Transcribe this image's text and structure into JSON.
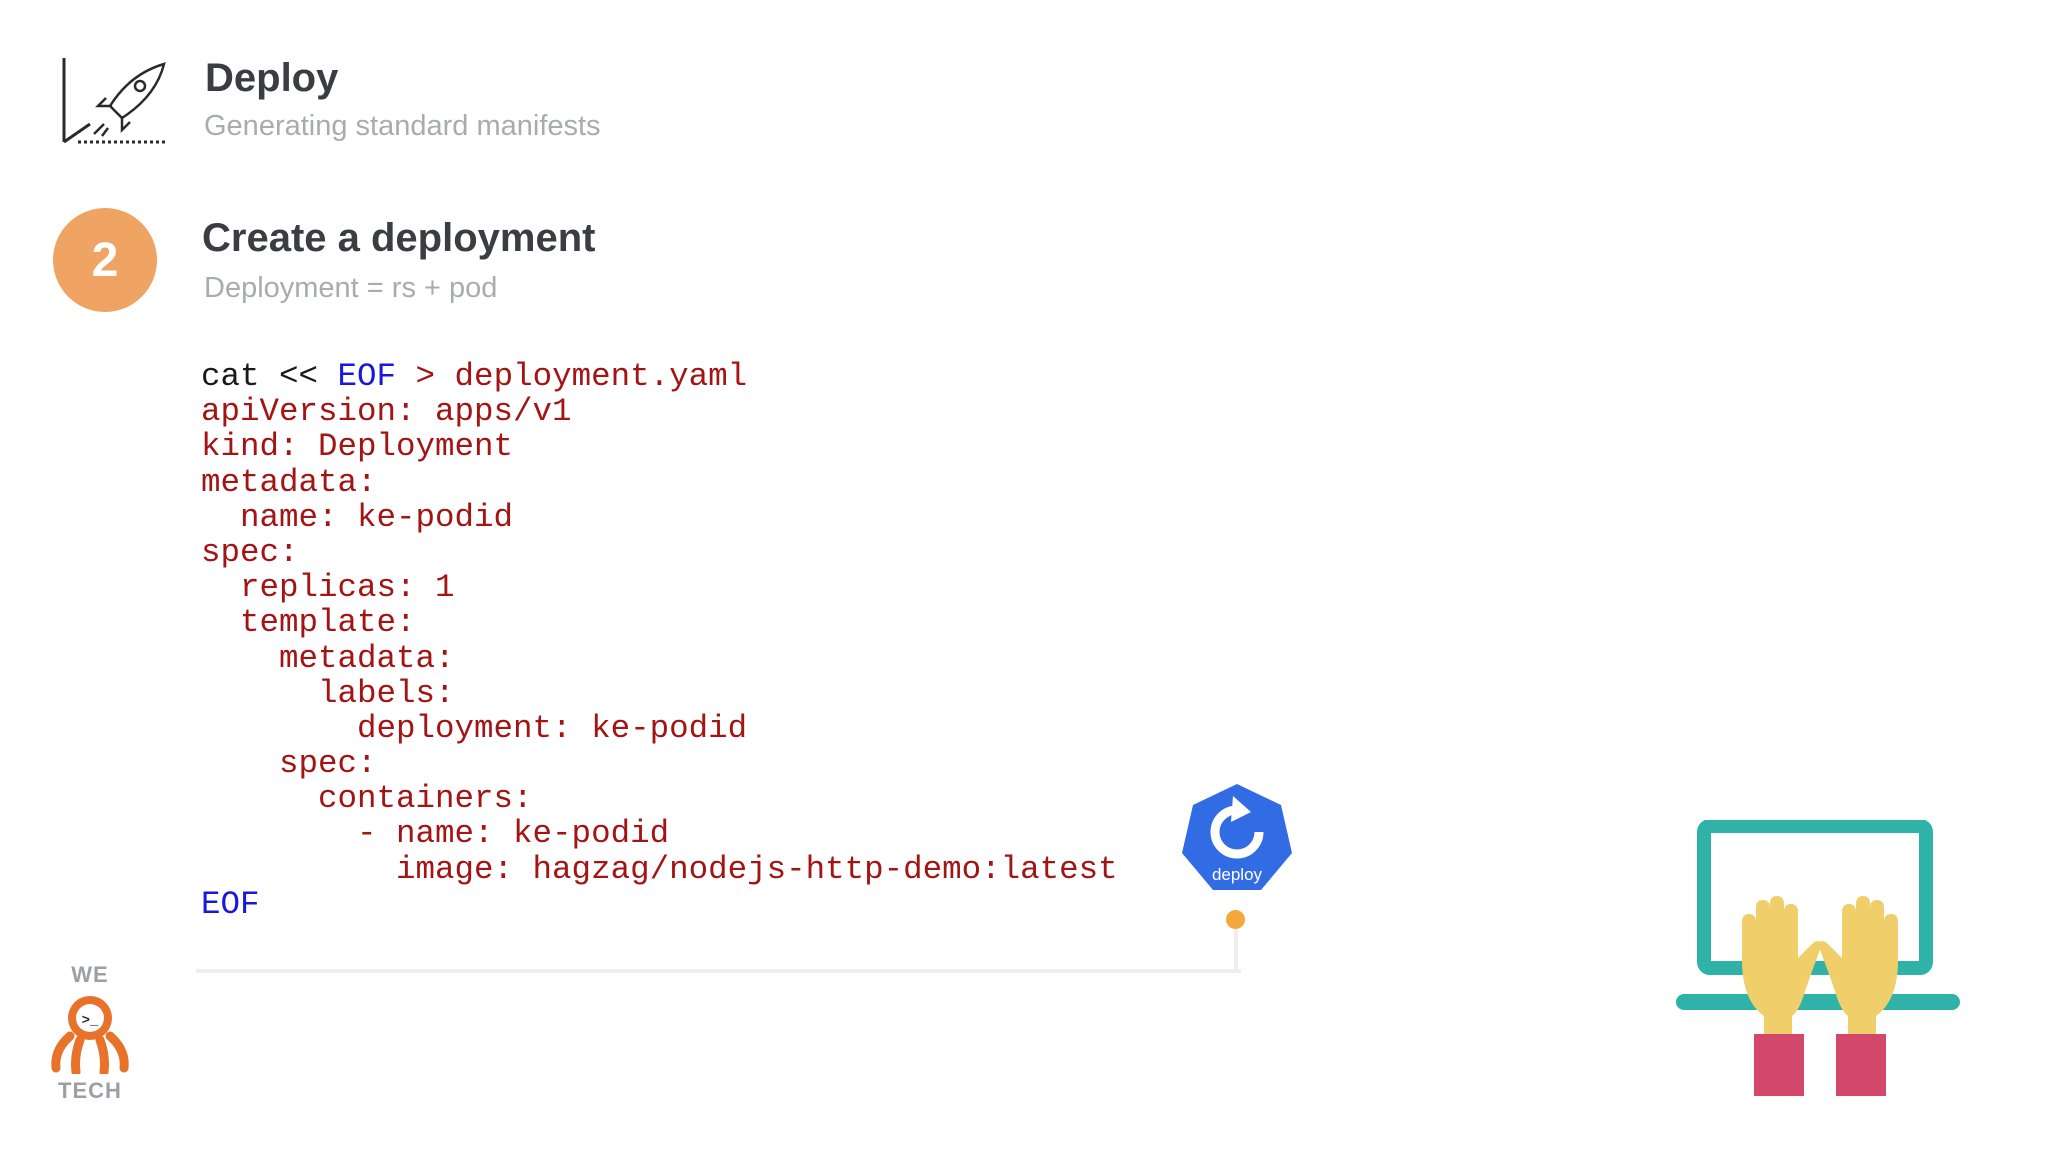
{
  "header": {
    "title": "Deploy",
    "subtitle": "Generating standard manifests",
    "icon": "rocket-chart-icon"
  },
  "step": {
    "number": "2",
    "title": "Create a deployment",
    "subtitle": "Deployment = rs + pod"
  },
  "code": {
    "line1_cmd": "cat << ",
    "line1_kw": "EOF",
    "line1_rest": " > deployment.yaml",
    "lines": [
      "apiVersion: apps/v1",
      "kind: Deployment",
      "metadata:",
      "  name: ke-podid",
      "spec:",
      "  replicas: 1",
      "  template:",
      "    metadata:",
      "      labels:",
      "        deployment: ke-podid",
      "    spec:",
      "      containers:",
      "        - name: ke-podid",
      "          image: hagzag/nodejs-http-demo:latest"
    ],
    "end": "EOF"
  },
  "deploy_badge": {
    "label": "deploy",
    "icon": "kubernetes-deploy-icon",
    "color": "#326ce5"
  },
  "logo": {
    "top": "WE",
    "bottom": "TECH",
    "icon": "octopus-logo-icon",
    "color": "#e8722a"
  },
  "illustration": {
    "icon": "laptop-typing-hands-icon"
  },
  "colors": {
    "accent": "#f0a463",
    "code_string": "#a31414",
    "code_keyword": "#1a18d8",
    "timeline_dot": "#f5a93c"
  }
}
